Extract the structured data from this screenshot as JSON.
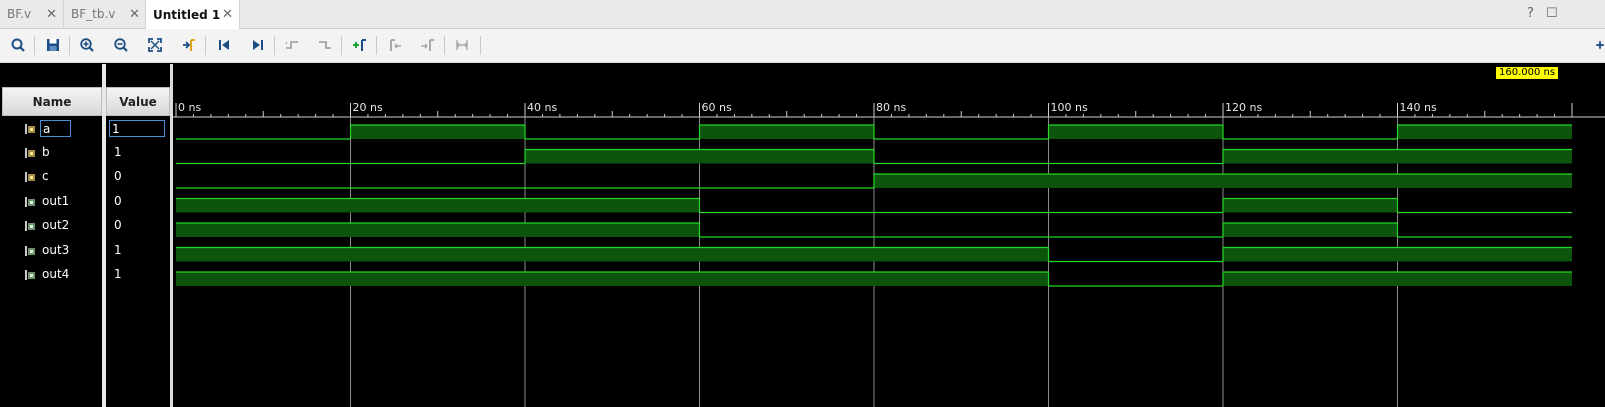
{
  "tabs": [
    {
      "label": "BF.v",
      "active": false
    },
    {
      "label": "BF_tb.v",
      "active": false
    },
    {
      "label": "Untitled 1",
      "active": true
    }
  ],
  "window_controls": {
    "help": "?",
    "maximize": "☐"
  },
  "toolbar": {
    "buttons": [
      {
        "name": "search-button",
        "icon": "search-icon"
      },
      {
        "name": "save-button",
        "icon": "save-icon"
      },
      {
        "name": "zoom-in-button",
        "icon": "zoom-in-icon"
      },
      {
        "name": "zoom-out-button",
        "icon": "zoom-out-icon"
      },
      {
        "name": "zoom-fit-button",
        "icon": "zoom-fit-icon"
      },
      {
        "name": "go-to-cursor-button",
        "icon": "go-to-cursor-icon"
      },
      {
        "name": "go-to-time-zero-button",
        "icon": "go-to-start-icon"
      },
      {
        "name": "go-to-last-time-button",
        "icon": "go-to-end-icon"
      },
      {
        "name": "previous-transition-button",
        "icon": "previous-transition-icon"
      },
      {
        "name": "next-transition-button",
        "icon": "next-transition-icon"
      },
      {
        "name": "add-marker-button",
        "icon": "add-marker-icon"
      },
      {
        "name": "previous-marker-button",
        "icon": "previous-marker-icon"
      },
      {
        "name": "next-marker-button",
        "icon": "next-marker-icon"
      },
      {
        "name": "swap-cursors-button",
        "icon": "swap-cursors-icon"
      }
    ]
  },
  "columns": {
    "name": "Name",
    "value": "Value"
  },
  "signals": [
    {
      "name": "a",
      "value": "1"
    },
    {
      "name": "b",
      "value": "1"
    },
    {
      "name": "c",
      "value": "0"
    },
    {
      "name": "out1",
      "value": "0"
    },
    {
      "name": "out2",
      "value": "0"
    },
    {
      "name": "out3",
      "value": "1"
    },
    {
      "name": "out4",
      "value": "1"
    }
  ],
  "timeline": {
    "unit": "ns",
    "range_ns": [
      0,
      160
    ],
    "major_labels": [
      "0 ns",
      "20 ns",
      "40 ns",
      "60 ns",
      "80 ns",
      "100 ns",
      "120 ns",
      "140 ns"
    ],
    "cursor_label": "160.000 ns"
  },
  "waveforms": {
    "a": [
      0,
      1,
      0,
      1,
      0,
      1,
      0,
      1
    ],
    "b": [
      0,
      0,
      1,
      1,
      0,
      0,
      1,
      1
    ],
    "c": [
      0,
      0,
      0,
      0,
      1,
      1,
      1,
      1
    ],
    "out1": [
      1,
      1,
      1,
      0,
      0,
      0,
      1,
      0
    ],
    "out2": [
      1,
      1,
      1,
      0,
      0,
      0,
      1,
      0
    ],
    "out3": [
      1,
      1,
      1,
      1,
      1,
      0,
      1,
      1
    ],
    "out4": [
      1,
      1,
      1,
      1,
      1,
      0,
      1,
      1
    ]
  },
  "colors": {
    "wave_line": "#22d822",
    "wave_fill": "#0d540d",
    "grid": "#8c8c8c",
    "cursor_bg": "#ffff00",
    "selection": "#4a8fd6"
  }
}
